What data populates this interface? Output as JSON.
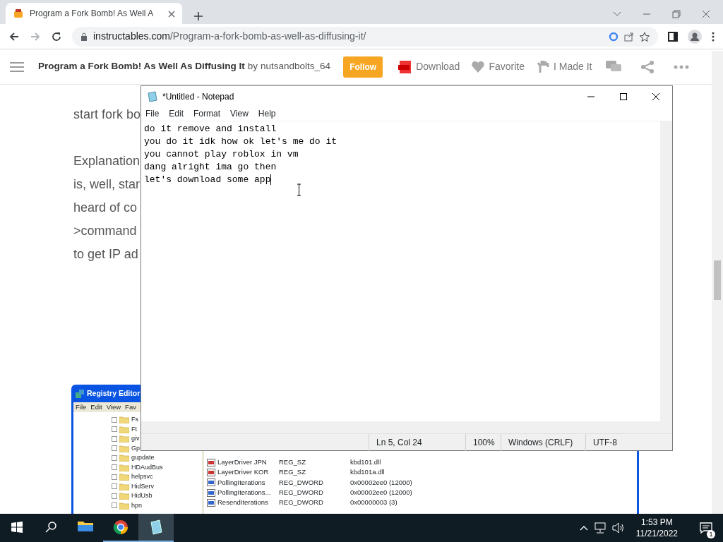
{
  "browser": {
    "tab": {
      "title": "Program a Fork Bomb! As Well A"
    },
    "address": {
      "host": "instructables.com",
      "path": "/Program-a-fork-bomb-as-well-as-diffusing-it/"
    }
  },
  "site_header": {
    "title": "Program a Fork Bomb! As Well As Diffusing It",
    "by": "by",
    "author": "nutsandbolts_64",
    "follow": "Follow",
    "actions": [
      {
        "kind": "download",
        "label": "Download"
      },
      {
        "kind": "favorite",
        "label": "Favorite"
      },
      {
        "kind": "made",
        "label": "I Made It"
      }
    ]
  },
  "article_paragraphs": [
    [
      "start fork bo"
    ],
    [
      "Explanation",
      "is, well, star",
      "heard of co",
      ">command",
      "to get IP ad"
    ]
  ],
  "registry_editor": {
    "title": "Registry Editor",
    "menu": [
      "File",
      "Edit",
      "View",
      "Fav"
    ],
    "tree": [
      "Fs",
      "Ft",
      "giv",
      "Gp",
      "gupdate",
      "HDAudBus",
      "helpsvc",
      "HidServ",
      "HidUsb",
      "hpn"
    ],
    "values": [
      {
        "kind": "string",
        "name": "LayerDriver JPN",
        "type": "REG_SZ",
        "data": "kbd101.dll"
      },
      {
        "kind": "string",
        "name": "LayerDriver KOR",
        "type": "REG_SZ",
        "data": "kbd101a.dll"
      },
      {
        "kind": "dword",
        "name": "PollingIterations",
        "type": "REG_DWORD",
        "data": "0x00002ee0 (12000)"
      },
      {
        "kind": "dword",
        "name": "PollingIterations...",
        "type": "REG_DWORD",
        "data": "0x00002ee0 (12000)"
      },
      {
        "kind": "dword",
        "name": "ResendIterations",
        "type": "REG_DWORD",
        "data": "0x00000003 (3)"
      }
    ]
  },
  "notepad": {
    "title": "*Untitled - Notepad",
    "menu": [
      "File",
      "Edit",
      "Format",
      "View",
      "Help"
    ],
    "lines": [
      "do it remove and install",
      "you do it idk how ok let's me do it",
      "you cannot play roblox in vm",
      "dang alright ima go then",
      "let's download some app"
    ],
    "status": [
      "Ln 5, Col 24",
      "100%",
      "Windows (CRLF)",
      "UTF-8"
    ]
  },
  "taskbar": {
    "apps": [
      {
        "kind": "explorer",
        "selected": false,
        "running": false
      },
      {
        "kind": "chrome",
        "selected": false,
        "running": true
      },
      {
        "kind": "notepad",
        "selected": true,
        "running": true
      }
    ],
    "time": "1:53 PM",
    "date": "11/21/2022",
    "notifications": "1"
  }
}
